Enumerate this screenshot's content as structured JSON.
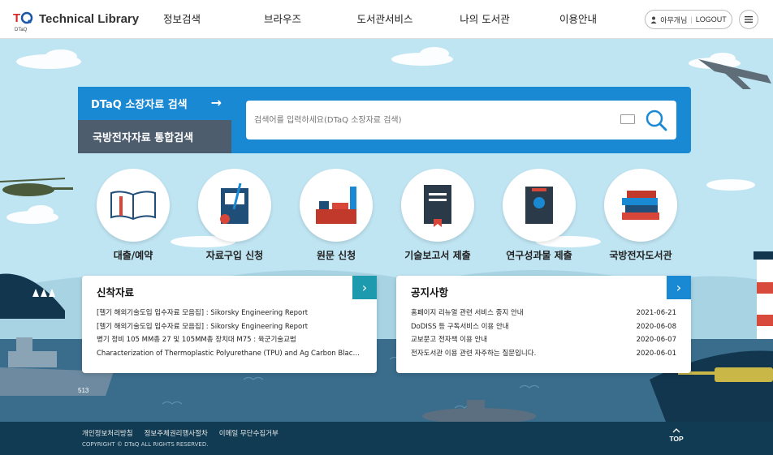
{
  "header": {
    "logo_text": "Technical Library",
    "logo_sub": "DTaQ",
    "nav": [
      "정보검색",
      "브라우즈",
      "도서관서비스",
      "나의 도서관",
      "이용안내"
    ],
    "user_name": "아무개님",
    "logout": "LOGOUT"
  },
  "search": {
    "tab_active": "DTaQ 소장자료 검색",
    "tab_active_arrow": "→",
    "tab_other": "국방전자자료 통합검색",
    "placeholder": "검색어를 입력하세요(DTaQ 소장자료 검색)"
  },
  "quick_links": [
    "대출/예약",
    "자료구입 신청",
    "원문 신청",
    "기술보고서 제출",
    "연구성과물 제출",
    "국방전자도서관"
  ],
  "new_items": {
    "title": "신착자료",
    "more": "›",
    "items": [
      "[헬기 해외기술도입 입수자료 모음집] : Sikorsky Engineering Report",
      "[헬기 해외기술도입 입수자료 모음집] : Sikorsky Engineering Report",
      "병기 정비 105 MM총 27 및 105MM총 장치대 M75 : 육군기술교범",
      "Characterization of Thermoplastic Polyurethane (TPU) and Ag Carbon Black..."
    ]
  },
  "notices": {
    "title": "공지사항",
    "more": "›",
    "items": [
      {
        "text": "홈페이지 리뉴얼 관련 서비스 중지 안내",
        "date": "2021-06-21"
      },
      {
        "text": "DoDISS 등 구독서비스 이용 안내",
        "date": "2020-06-08"
      },
      {
        "text": "교보문고 전자책 이용 안내",
        "date": "2020-06-07"
      },
      {
        "text": "전자도서관 이용 관련 자주하는 질문입니다.",
        "date": "2020-06-01"
      }
    ]
  },
  "footer": {
    "links": [
      "개인정보처리방침",
      "정보주체권리행사절차",
      "이메일 무단수집거부"
    ],
    "copyright": "COPYRIGHT © DTaQ ALL RIGHTS RESERVED.",
    "top": "TOP"
  },
  "ship_number": "513",
  "colors": {
    "accent": "#1a89d4",
    "tab_dark": "#4d5d6e",
    "teal": "#1e9aae",
    "sky": "#bfe4f2",
    "sea": "#3a6d8c",
    "footer": "#103b52"
  }
}
